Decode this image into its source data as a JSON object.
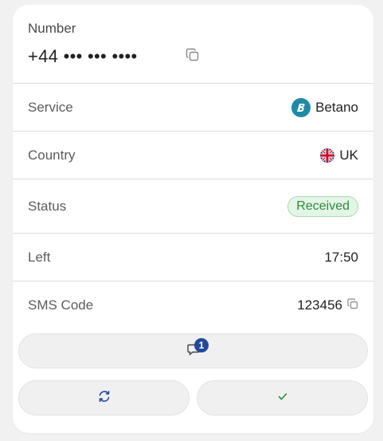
{
  "number": {
    "label": "Number",
    "value": "+44 ••• ••• ••••"
  },
  "rows": {
    "service": {
      "label": "Service",
      "value": "Betano"
    },
    "country": {
      "label": "Country",
      "value": "UK"
    },
    "status": {
      "label": "Status",
      "value": "Received"
    },
    "left": {
      "label": "Left",
      "value": "17:50"
    },
    "sms": {
      "label": "SMS Code",
      "value": "123456"
    }
  },
  "messages": {
    "badge_count": "1"
  },
  "colors": {
    "accent": "#22489a",
    "status_green": "#2f8a3a",
    "service_brand": "#1f8aa6"
  },
  "icons": {
    "copy": "copy-icon",
    "chat": "chat-icon",
    "refresh": "refresh-icon",
    "check": "check-icon",
    "service_logo": "betano-logo-icon",
    "flag": "uk-flag-icon"
  }
}
